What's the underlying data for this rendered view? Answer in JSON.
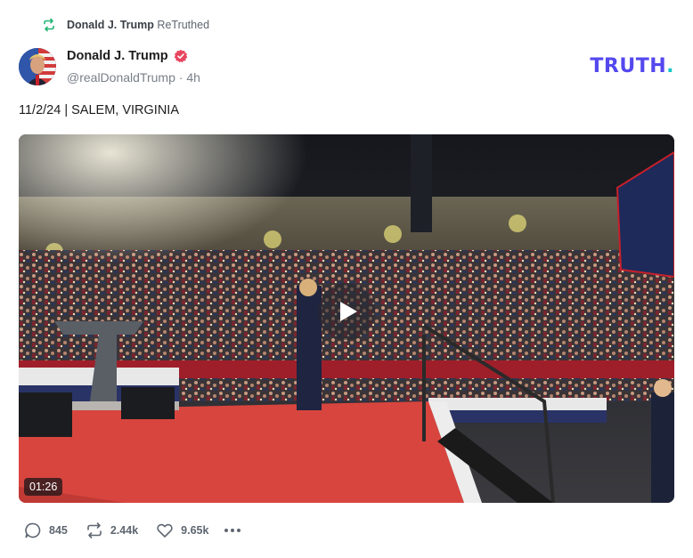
{
  "retruth": {
    "author": "Donald J. Trump",
    "action": "ReTruthed"
  },
  "post": {
    "author_name": "Donald J. Trump",
    "handle": "@realDonaldTrump",
    "separator": "·",
    "time_ago": "4h",
    "text": "11/2/24 | SALEM, VIRGINIA"
  },
  "brand": {
    "text": "TRUTH",
    "dot": "."
  },
  "video": {
    "duration": "01:26"
  },
  "actions": {
    "replies": "845",
    "retruths": "2.44k",
    "likes": "9.65k"
  },
  "colors": {
    "brand": "#5448ee",
    "brand_dot": "#17c6c6",
    "verified": "#e8455e",
    "retruth_icon": "#22b573"
  },
  "icons": {
    "retruth": "retruth-icon",
    "verified": "verified-badge-icon",
    "play": "play-icon",
    "reply": "reply-icon",
    "retruth_action": "retruth-action-icon",
    "like": "heart-icon",
    "more": "more-icon"
  }
}
